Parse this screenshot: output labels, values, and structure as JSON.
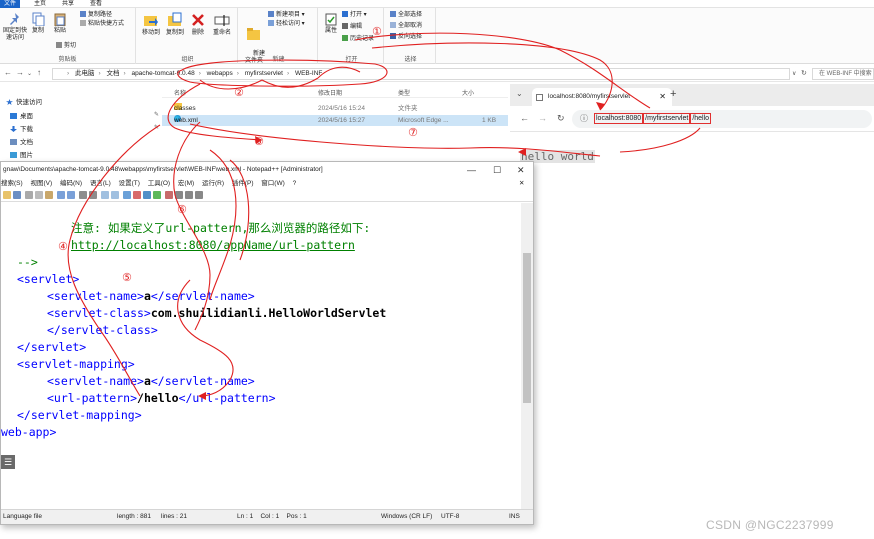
{
  "explorer": {
    "tabs": [
      "文件",
      "主页",
      "共享",
      "查看"
    ],
    "ribbon": {
      "clipboard": {
        "label": "剪贴板",
        "pin": "固定到快速访问",
        "copy": "复制",
        "paste": "粘贴",
        "copy_path": "复制路径",
        "paste_shortcut": "粘贴快捷方式",
        "cut": "剪切"
      },
      "organize": {
        "label": "组织",
        "move_to": "移动到",
        "copy_to": "复制到",
        "delete": "删除",
        "rename": "重命名"
      },
      "new": {
        "label": "新建",
        "new_folder": "新建\n文件夹",
        "new_item": "新建项目",
        "easy_access": "轻松访问"
      },
      "open": {
        "label": "打开",
        "properties": "属性",
        "open": "打开",
        "edit": "编辑",
        "history": "历史记录"
      },
      "select": {
        "label": "选择",
        "select_all": "全部选择",
        "select_none": "全部取消",
        "invert": "反向选择"
      }
    },
    "address_path": [
      "此电脑",
      "文档",
      "apache-tomcat-9.0.48",
      "webapps",
      "myfirstservlet",
      "WEB-INF"
    ],
    "search_placeholder": "在 WEB-INF 中搜索",
    "nav_pane": [
      "快速访问",
      "桌面",
      "下载",
      "文档",
      "图片"
    ],
    "columns": [
      "名称",
      "修改日期",
      "类型",
      "大小"
    ],
    "files": [
      {
        "name": "classes",
        "date": "2024/5/16 15:24",
        "type": "文件夹",
        "size": ""
      },
      {
        "name": "web.xml",
        "date": "2024/5/16 15:27",
        "type": "Microsoft Edge ...",
        "size": "1 KB"
      }
    ]
  },
  "browser": {
    "tab_title": "localhost:8080/myfirstservlet",
    "new_tab": "+",
    "url_host": "localhost:8080",
    "url_app": "/myfirstservlet",
    "url_pattern": "/hello",
    "content": "hello world"
  },
  "notepad": {
    "title": "gnaw\\Documents\\apache-tomcat-9.0.48\\webapps\\myfirstservlet\\WEB-INF\\web.xml - Notepad++ [Administrator]",
    "menu": [
      "搜索(S)",
      "视图(V)",
      "编码(N)",
      "语言(L)",
      "设置(T)",
      "工具(O)",
      "宏(M)",
      "运行(R)",
      "插件(P)",
      "窗口(W)",
      "?"
    ],
    "lines": {
      "l1_comment": "注意: 如果定义了url-pattern,那么浏览器的路径如下:",
      "l2_link": "http://localhost:8080/appName/url-pattern",
      "l3_close": "-->",
      "servlet_open": "<servlet>",
      "sname_open": "<servlet-name>",
      "sname_val": "a",
      "sname_close": "</servlet-name>",
      "sclass_open": "<servlet-class>",
      "sclass_val": "com.shuilidianli.HelloWorldServlet",
      "sclass_close": "</servlet-class>",
      "servlet_close": "</servlet>",
      "mapping_open": "<servlet-mapping>",
      "mname_open": "<servlet-name>",
      "mname_val": "a",
      "mname_close": "</servlet-name>",
      "url_open": "<url-pattern>",
      "url_val": "/hello",
      "url_close": "</url-pattern>",
      "mapping_close": "</servlet-mapping>",
      "webapp_close": "web-app>"
    },
    "status": {
      "language": "Language file",
      "length": "length : 881",
      "lines": "lines : 21",
      "position": "Ln : 1    Col : 1    Pos : 1",
      "eol": "Windows (CR LF)",
      "encoding": "UTF-8",
      "mode": "INS"
    }
  },
  "annotations": [
    "①",
    "②",
    "③",
    "④",
    "⑤",
    "⑥",
    "⑦"
  ],
  "watermark": "CSDN @NGC2237999",
  "colors": {
    "annotation": "#e02020",
    "folder": "#f4c542",
    "explorer_accent": "#1a64c8"
  }
}
